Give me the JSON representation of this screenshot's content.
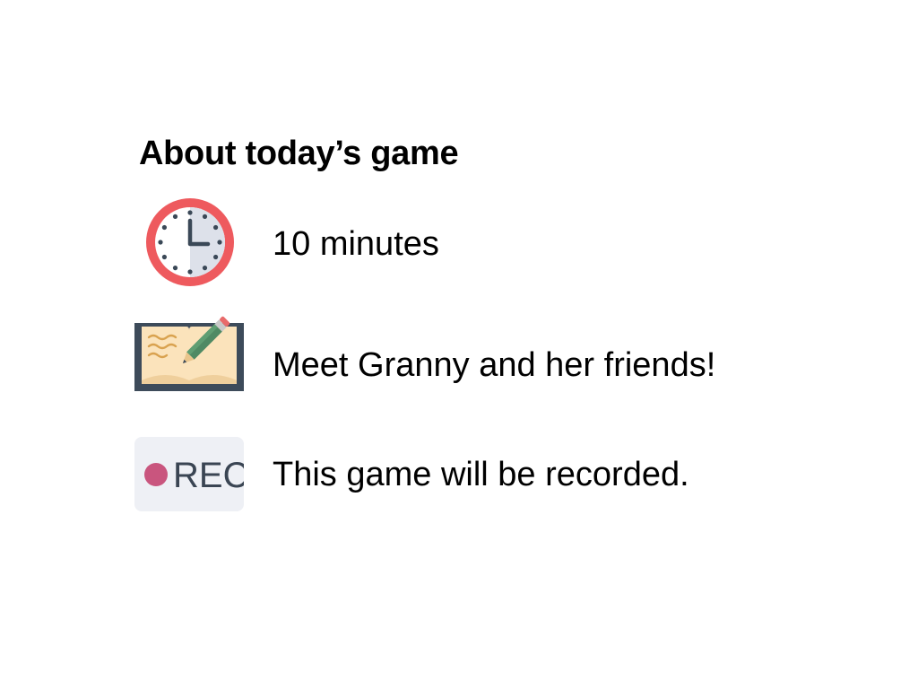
{
  "info": {
    "title": "About today’s game",
    "items": [
      {
        "icon": "clock-icon",
        "text": "10 minutes"
      },
      {
        "icon": "journal-pencil-icon",
        "text": "Meet Granny and her friends!"
      },
      {
        "icon": "rec-badge-icon",
        "text": "This game will be recorded.",
        "badge_text": "REC"
      }
    ]
  },
  "colors": {
    "clock_ring": "#ee5a5e",
    "clock_face": "#ffffff",
    "clock_half": "#dde1ea",
    "clock_ink": "#3a4857",
    "book_cover": "#3d4b5a",
    "book_page": "#fbe3bb",
    "pencil_body": "#4f8a64",
    "pencil_tip": "#e9c58c",
    "rec_dot": "#c9557e",
    "rec_bg": "#eef0f5"
  }
}
